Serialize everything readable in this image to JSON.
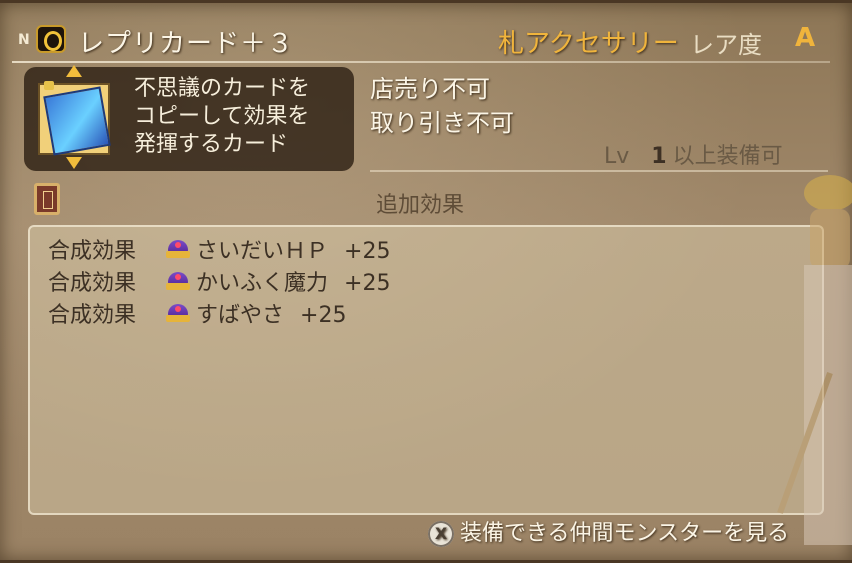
{
  "header": {
    "rarity_badge": "N",
    "item_name": "レプリカード＋３",
    "category": "札アクセサリー",
    "rarity_label": "レア度",
    "rarity_value": "A"
  },
  "item": {
    "description_lines": [
      "不思議のカードを",
      "コピーして効果を",
      "発揮するカード"
    ],
    "properties": {
      "sell": "店売り不可",
      "trade": "取り引き不可"
    },
    "equip": {
      "lv_label": "Lv",
      "lv_value": "1",
      "lv_suffix": "以上装備可"
    }
  },
  "effects": {
    "title": "追加効果",
    "rows": [
      {
        "label": "合成効果",
        "stat": "さいだいＨＰ",
        "value": "+25"
      },
      {
        "label": "合成効果",
        "stat": "かいふく魔力",
        "value": "+25"
      },
      {
        "label": "合成効果",
        "stat": "すばやさ",
        "value": "+25"
      }
    ]
  },
  "footer": {
    "button_glyph": "X",
    "action_label": "装備できる仲間モンスターを見る"
  },
  "icons": {
    "ring": "ring-icon",
    "card": "card-icon",
    "lock": "lock-icon",
    "book": "book-icon",
    "crown": "crown-icon",
    "button": "x-button-icon"
  },
  "colors": {
    "category": "#f0b43c",
    "rarity_value": "#f0b43c",
    "effect_text": "#3c3024"
  }
}
